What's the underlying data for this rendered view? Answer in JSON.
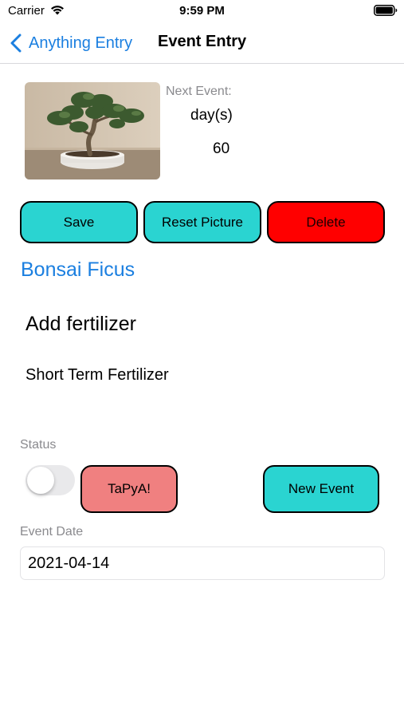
{
  "status_bar": {
    "carrier": "Carrier",
    "time": "9:59 PM",
    "icons": [
      "wifi-icon",
      "battery-icon"
    ]
  },
  "nav": {
    "back_label": "Anything Entry",
    "title": "Event Entry",
    "accent_color": "#1b7fe0"
  },
  "header": {
    "next_event_label": "Next Event:",
    "days_label": "day(s)",
    "days_value": "60"
  },
  "buttons": {
    "save": "Save",
    "reset_picture": "Reset Picture",
    "delete": "Delete",
    "tapya": "TaPyA!",
    "new_event": "New Event"
  },
  "colors": {
    "primary_button": "#2ad4d1",
    "delete_button": "#ff0000",
    "tapya_button": "#f08080"
  },
  "item": {
    "name": "Bonsai Ficus"
  },
  "event": {
    "title": "Add fertilizer",
    "subtitle": "Short Term Fertilizer"
  },
  "status": {
    "label": "Status",
    "toggle_on": false
  },
  "event_date": {
    "label": "Event Date",
    "value": "2021-04-14"
  }
}
